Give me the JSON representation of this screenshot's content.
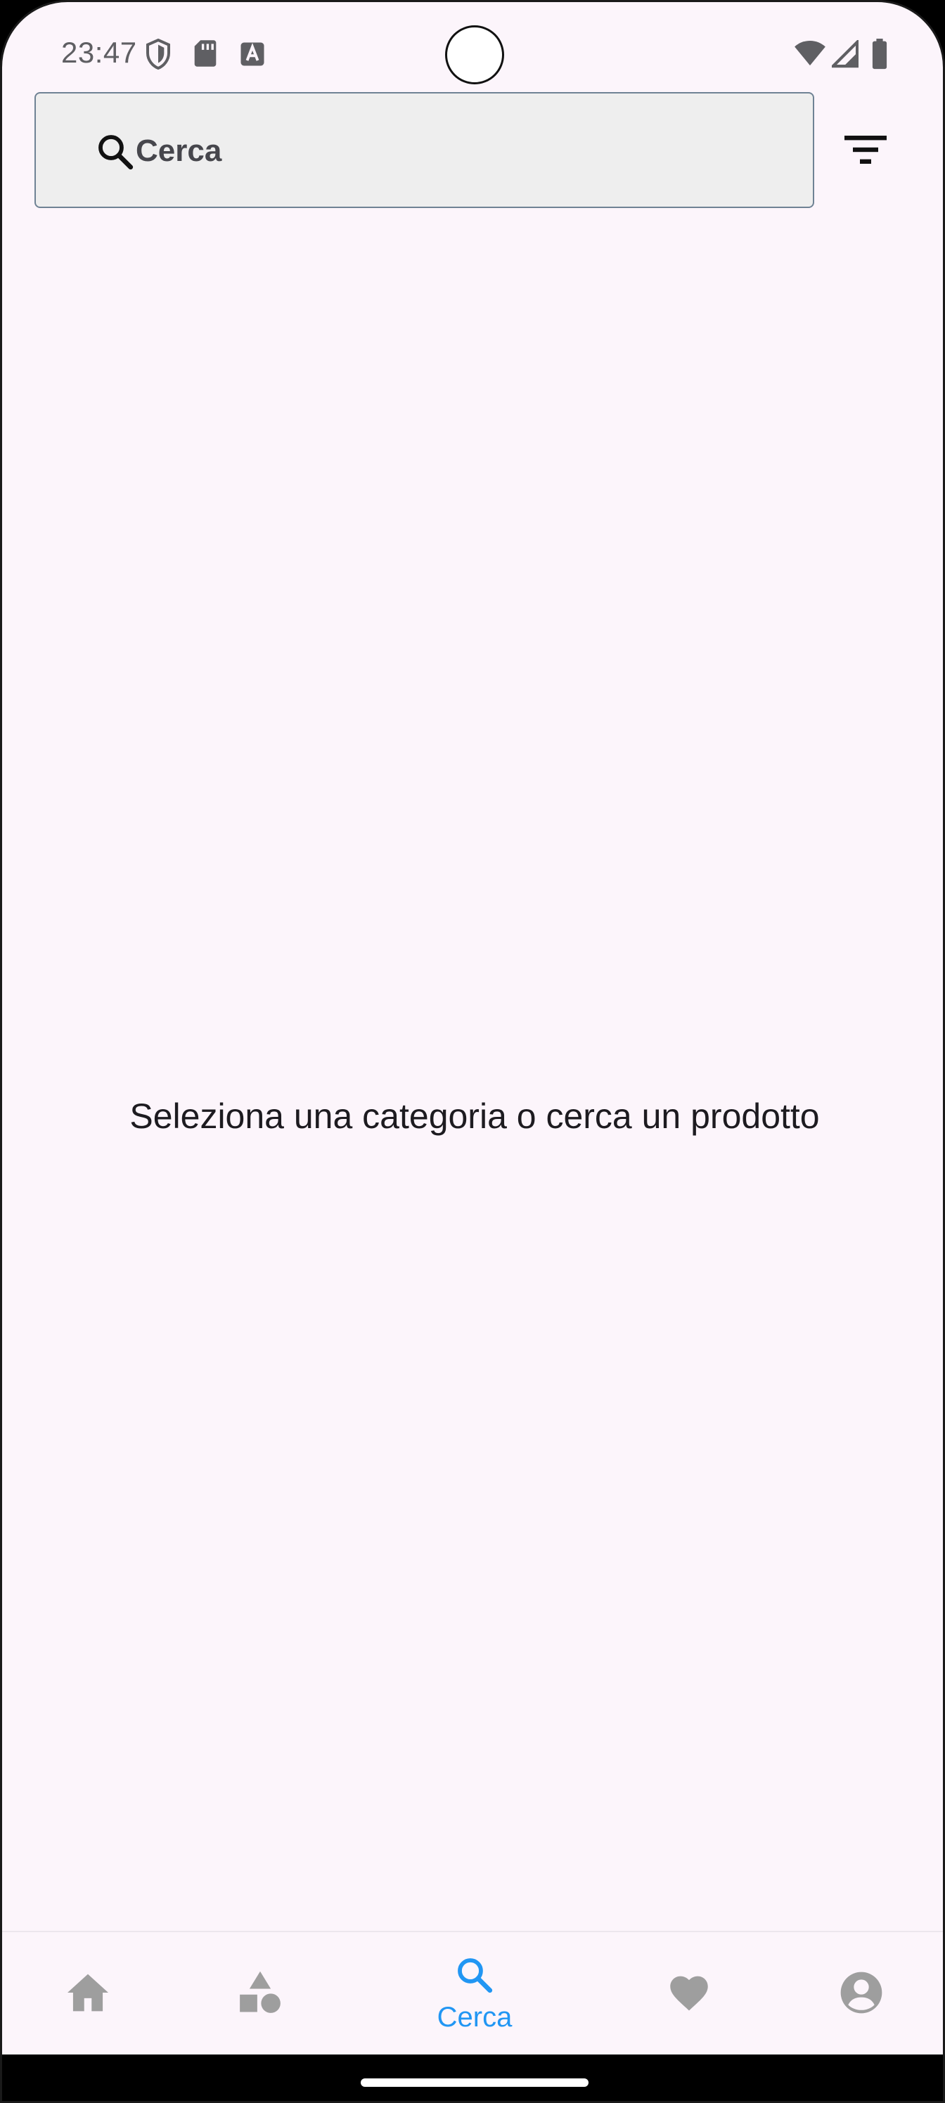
{
  "status_bar": {
    "time": "23:47",
    "icons": [
      "shield-icon",
      "sd-card-icon",
      "text-a-icon",
      "wifi-icon",
      "signal-icon",
      "battery-icon"
    ]
  },
  "search": {
    "placeholder": "Cerca",
    "value": "",
    "icon": "search-icon"
  },
  "filter": {
    "icon": "filter-icon"
  },
  "main": {
    "empty_message": "Seleziona una categoria o cerca un prodotto"
  },
  "bottom_nav": {
    "active_color": "#2196f3",
    "inactive_color": "#9e9e9e",
    "items": [
      {
        "icon": "home-icon",
        "label": ""
      },
      {
        "icon": "categories-icon",
        "label": ""
      },
      {
        "icon": "search-icon",
        "label": "Cerca"
      },
      {
        "icon": "heart-icon",
        "label": ""
      },
      {
        "icon": "account-icon",
        "label": ""
      }
    ],
    "active_index": 2
  },
  "colors": {
    "background": "#fcf5fb",
    "search_field": "#eeeeee",
    "text": "#1d1b20"
  }
}
